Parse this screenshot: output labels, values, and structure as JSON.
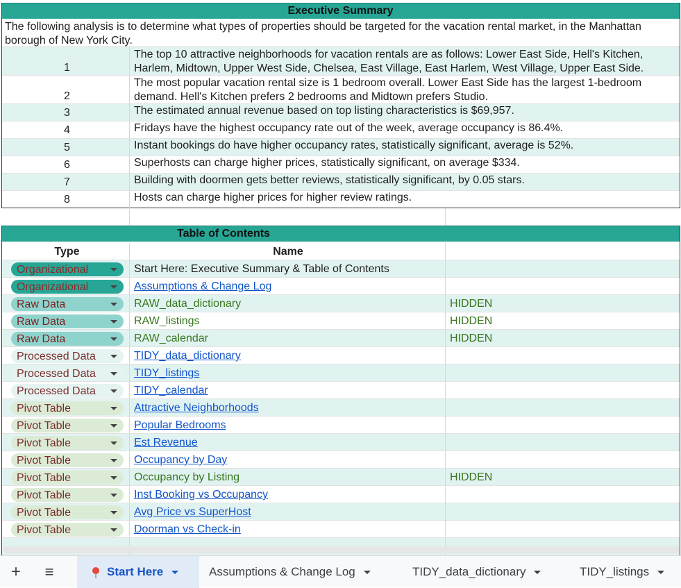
{
  "summary": {
    "title": "Executive Summary",
    "intro": "The following analysis is to determine what types of properties should be targeted for the vacation rental market, in the Manhattan borough of New York City.",
    "items": [
      {
        "num": "1",
        "text": "The top 10 attractive neighborhoods for vacation rentals are as follows: Lower East Side, Hell's Kitchen, Harlem, Midtown, Upper West Side, Chelsea, East Village, East Harlem, West Village, Upper East Side."
      },
      {
        "num": "2",
        "text": "The most popular vacation rental size is 1 bedroom overall. Lower East Side has the largest 1-bedroom demand. Hell's Kitchen prefers 2 bedrooms and Midtown prefers Studio."
      },
      {
        "num": "3",
        "text": "The estimated annual revenue based on top listing characteristics is $69,957."
      },
      {
        "num": "4",
        "text": "Fridays have the highest occupancy rate out of the week, average occupancy is 86.4%."
      },
      {
        "num": "5",
        "text": "Instant bookings do have higher occupancy rates, statistically significant, average is 52%."
      },
      {
        "num": "6",
        "text": "Superhosts can charge higher prices, statistically significant, on average $334."
      },
      {
        "num": "7",
        "text": "Building with doormen gets better reviews, statistically significant, by 0.05 stars."
      },
      {
        "num": "8",
        "text": "Hosts can charge higher prices for higher review ratings."
      }
    ]
  },
  "toc": {
    "title": "Table of Contents",
    "col_type": "Type",
    "col_name": "Name",
    "rows": [
      {
        "type": "Organizational",
        "name": "Start Here: Executive Summary & Table of Contents",
        "flag": ""
      },
      {
        "type": "Organizational",
        "name": "Assumptions & Change Log",
        "flag": ""
      },
      {
        "type": "Raw Data",
        "name": "RAW_data_dictionary",
        "flag": "HIDDEN"
      },
      {
        "type": "Raw Data",
        "name": "RAW_listings",
        "flag": "HIDDEN"
      },
      {
        "type": "Raw Data",
        "name": "RAW_calendar",
        "flag": "HIDDEN"
      },
      {
        "type": "Processed Data",
        "name": "TIDY_data_dictionary",
        "flag": ""
      },
      {
        "type": "Processed Data",
        "name": "TIDY_listings",
        "flag": ""
      },
      {
        "type": "Processed Data",
        "name": "TIDY_calendar",
        "flag": ""
      },
      {
        "type": "Pivot Table",
        "name": "Attractive Neighborhoods",
        "flag": ""
      },
      {
        "type": "Pivot Table",
        "name": "Popular Bedrooms",
        "flag": ""
      },
      {
        "type": "Pivot Table",
        "name": "Est Revenue",
        "flag": ""
      },
      {
        "type": "Pivot Table",
        "name": "Occupancy by Day",
        "flag": ""
      },
      {
        "type": "Pivot Table",
        "name": "Occupancy by Listing",
        "flag": "HIDDEN"
      },
      {
        "type": "Pivot Table",
        "name": "Inst Booking vs Occupancy",
        "flag": ""
      },
      {
        "type": "Pivot Table",
        "name": "Avg Price vs SuperHost",
        "flag": ""
      },
      {
        "type": "Pivot Table",
        "name": "Doorman vs Check-in",
        "flag": ""
      }
    ]
  },
  "tabs": {
    "add_label": "+",
    "menu_label": "≡",
    "items": [
      {
        "label": "Start Here",
        "active": true
      },
      {
        "label": "Assumptions & Change Log",
        "active": false
      },
      {
        "label": "TIDY_data_dictionary",
        "active": false
      },
      {
        "label": "TIDY_listings",
        "active": false
      }
    ]
  },
  "colors": {
    "header": "#27a696",
    "band": "#e1f3f1",
    "link": "#1155cc",
    "hidden": "#38761d"
  }
}
